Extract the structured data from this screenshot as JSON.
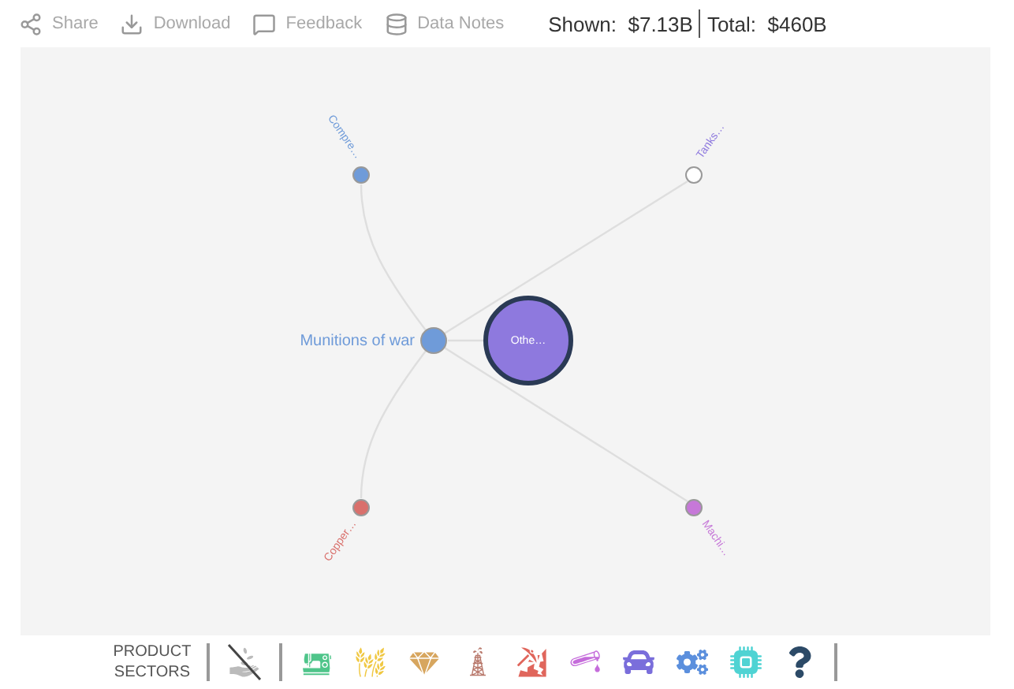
{
  "toolbar": {
    "actions": [
      {
        "label": "Share"
      },
      {
        "label": "Download"
      },
      {
        "label": "Feedback"
      },
      {
        "label": "Data Notes"
      }
    ],
    "shown": {
      "label": "Shown:",
      "value": "$7.13B"
    },
    "total": {
      "label": "Total:",
      "value": "$460B"
    }
  },
  "network": {
    "center": {
      "label": "Munitions of war",
      "color": "#6f9bd9"
    },
    "focus": {
      "label": "Othe…",
      "color": "#8e79de"
    },
    "nodes": [
      {
        "label": "Compre…",
        "color": "#6f9bd9",
        "hollow": false
      },
      {
        "label": "Tanks…",
        "color": "#8e79de",
        "hollow": true
      },
      {
        "label": "Copper…",
        "color": "#d9706c",
        "hollow": false
      },
      {
        "label": "Machi…",
        "color": "#c678d8",
        "hollow": false
      }
    ]
  },
  "sectors": {
    "label_lines": [
      "PRODUCT",
      "SECTORS"
    ],
    "items": [
      {
        "color": "#bbbbbb",
        "disabled": true
      },
      {
        "color": "#4fc58a",
        "disabled": false
      },
      {
        "color": "#f0c843",
        "disabled": false
      },
      {
        "color": "#d7a65f",
        "disabled": false
      },
      {
        "color": "#b9796c",
        "disabled": false
      },
      {
        "color": "#e0665c",
        "disabled": false
      },
      {
        "color": "#c56cdb",
        "disabled": false
      },
      {
        "color": "#7a6edb",
        "disabled": false
      },
      {
        "color": "#5b8fdd",
        "disabled": false
      },
      {
        "color": "#4fd3d3",
        "disabled": false
      },
      {
        "color": "#2c4a67",
        "disabled": false
      }
    ]
  }
}
